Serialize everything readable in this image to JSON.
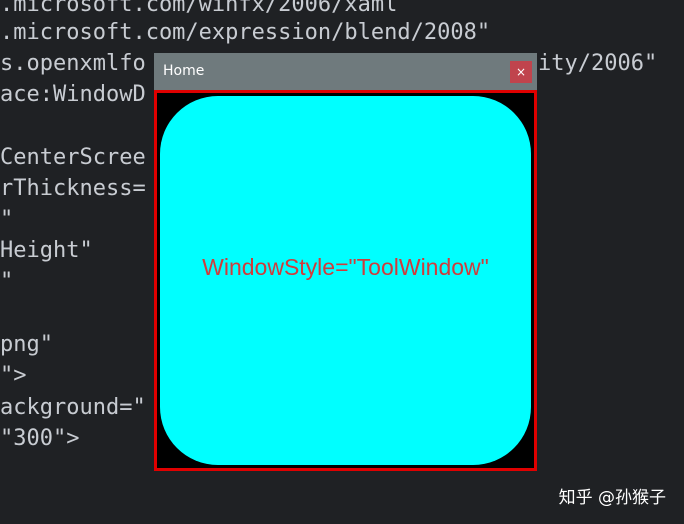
{
  "code_lines": [
    ".microsoft.com/winfx/2006/xaml",
    ".microsoft.com/expression/blend/2008\"",
    "s.openxmlfo",
    "ity/2006\"",
    "ace:WindowD",
    "CenterScree",
    "rThickness=",
    "\"",
    "Height\"",
    "\"",
    "png\"",
    "\">",
    "ackground=\"",
    "\"300\">"
  ],
  "window": {
    "title": "Home",
    "close_glyph": "×",
    "panel_text": "WindowStyle=\"ToolWindow\""
  },
  "watermark": "知乎 @孙猴子",
  "colors": {
    "editor_bg": "#1f2124",
    "titlebar": "#6f7a7d",
    "close_button": "#c0444d",
    "border": "#e00000",
    "panel": "#00ffff",
    "panel_text": "#d03c3c"
  }
}
